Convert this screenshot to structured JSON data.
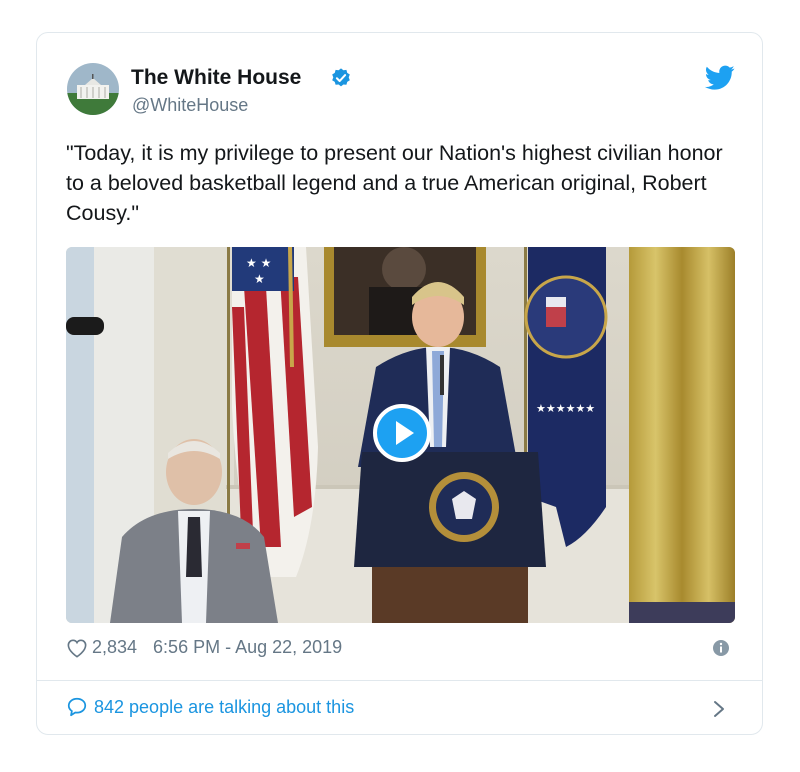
{
  "account": {
    "name": "The White House",
    "handle": "@WhiteHouse"
  },
  "tweet": {
    "text": "\"Today, it is my privilege to present our Nation's highest civilian honor to a beloved basketball legend and a true American original, Robert Cousy.\""
  },
  "stats": {
    "likes": "2,834",
    "timestamp": "6:56 PM - Aug 22, 2019"
  },
  "conversation": {
    "label": "842 people are talking about this"
  },
  "icons": {
    "avatar": "white-house-avatar",
    "verified": "verified-badge-icon",
    "brand": "twitter-bird-icon",
    "play": "play-icon",
    "like": "heart-icon",
    "info": "info-icon",
    "reply": "speech-bubble-icon",
    "more": "chevron-right-icon"
  },
  "colors": {
    "accent": "#1b95e0",
    "text": "#14171a",
    "muted": "#657786",
    "border": "#e1e8ed"
  }
}
